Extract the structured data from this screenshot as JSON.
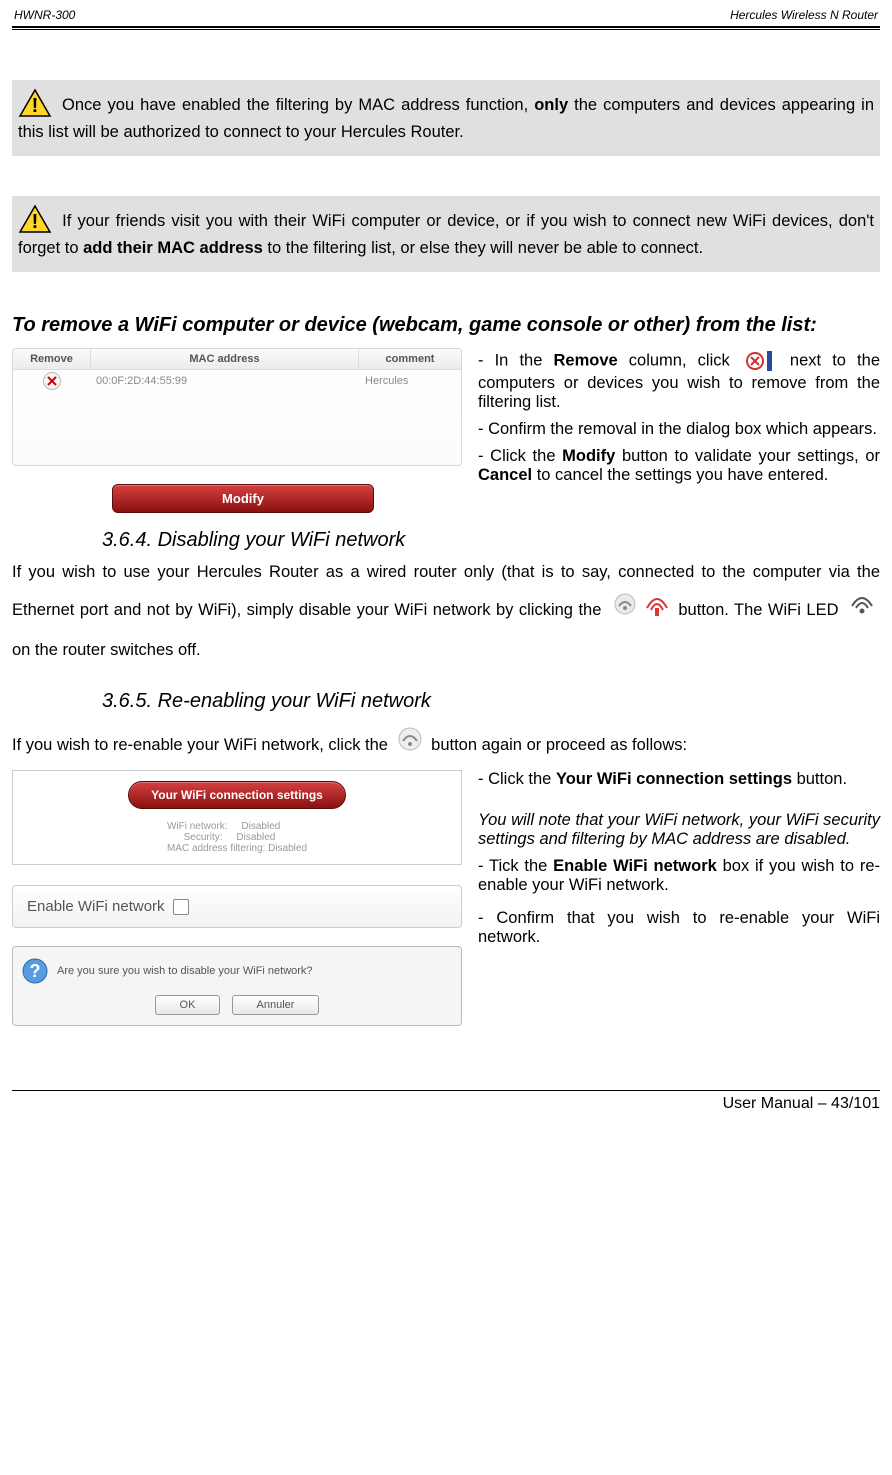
{
  "header": {
    "left": "HWNR-300",
    "right": "Hercules Wireless N Router"
  },
  "warn1": {
    "pre": "Once you have enabled the filtering by MAC address function, ",
    "bold": "only",
    "post": " the computers and devices appearing in this list will be authorized to connect to your Hercules Router."
  },
  "warn2": {
    "pre": "If your friends visit you with their WiFi computer or device, or if you wish to connect new WiFi devices, don't forget to ",
    "bold": "add their MAC address",
    "post": " to the filtering list, or else they will never be able to connect."
  },
  "remove_section_title": "To remove a WiFi computer or device (webcam, game console or other) from the list:",
  "table": {
    "h_remove": "Remove",
    "h_mac": "MAC address",
    "h_comment": "comment",
    "row": {
      "mac": "00:0F:2D:44:55:99",
      "comment": "Hercules"
    }
  },
  "modify_label": "Modify",
  "remove_steps": {
    "s1a": "- In the ",
    "s1b": "Remove",
    "s1c": " column, click ",
    "s1d": " next to the computers or devices you wish to remove from the filtering list.",
    "s2": "- Confirm the removal in the dialog box which appears.",
    "s3a": "- Click the ",
    "s3b": "Modify",
    "s3c": " button to validate your settings, or ",
    "s3d": "Cancel",
    "s3e": " to cancel the settings you have entered."
  },
  "sub364": "3.6.4. Disabling your WiFi network",
  "disable_para": {
    "a": "If you wish to use your Hercules Router as a wired router only (that is to say, connected to the computer via the Ethernet port and not by WiFi), simply disable your WiFi network by clicking the ",
    "b": " button.  The WiFi LED ",
    "c": " on the router switches off."
  },
  "sub365": "3.6.5. Re-enabling your WiFi network",
  "reenable_intro_a": "If you wish to re-enable your WiFi network, click the ",
  "reenable_intro_b": " button again or proceed as follows:",
  "settings_button_label": "Your WiFi connection settings",
  "panel_info": "WiFi network:     Disabled\n      Security:     Disabled\nMAC address filtering: Disabled",
  "enable_label": "Enable WiFi network",
  "dialog_msg": "Are you sure you wish to disable your WiFi network?",
  "dialog_ok": "OK",
  "dialog_cancel": "Annuler",
  "reenable_steps": {
    "s1a": "- Click the ",
    "s1b": "Your WiFi connection settings",
    "s1c": " button.",
    "note": "You will note that your WiFi network, your WiFi security settings and filtering by MAC address are disabled.",
    "s2a": "- Tick the ",
    "s2b": "Enable WiFi network",
    "s2c": " box if you wish to re-enable your WiFi network.",
    "s3": "- Confirm that you wish to re-enable your WiFi network."
  },
  "footer": "User Manual – 43/101"
}
